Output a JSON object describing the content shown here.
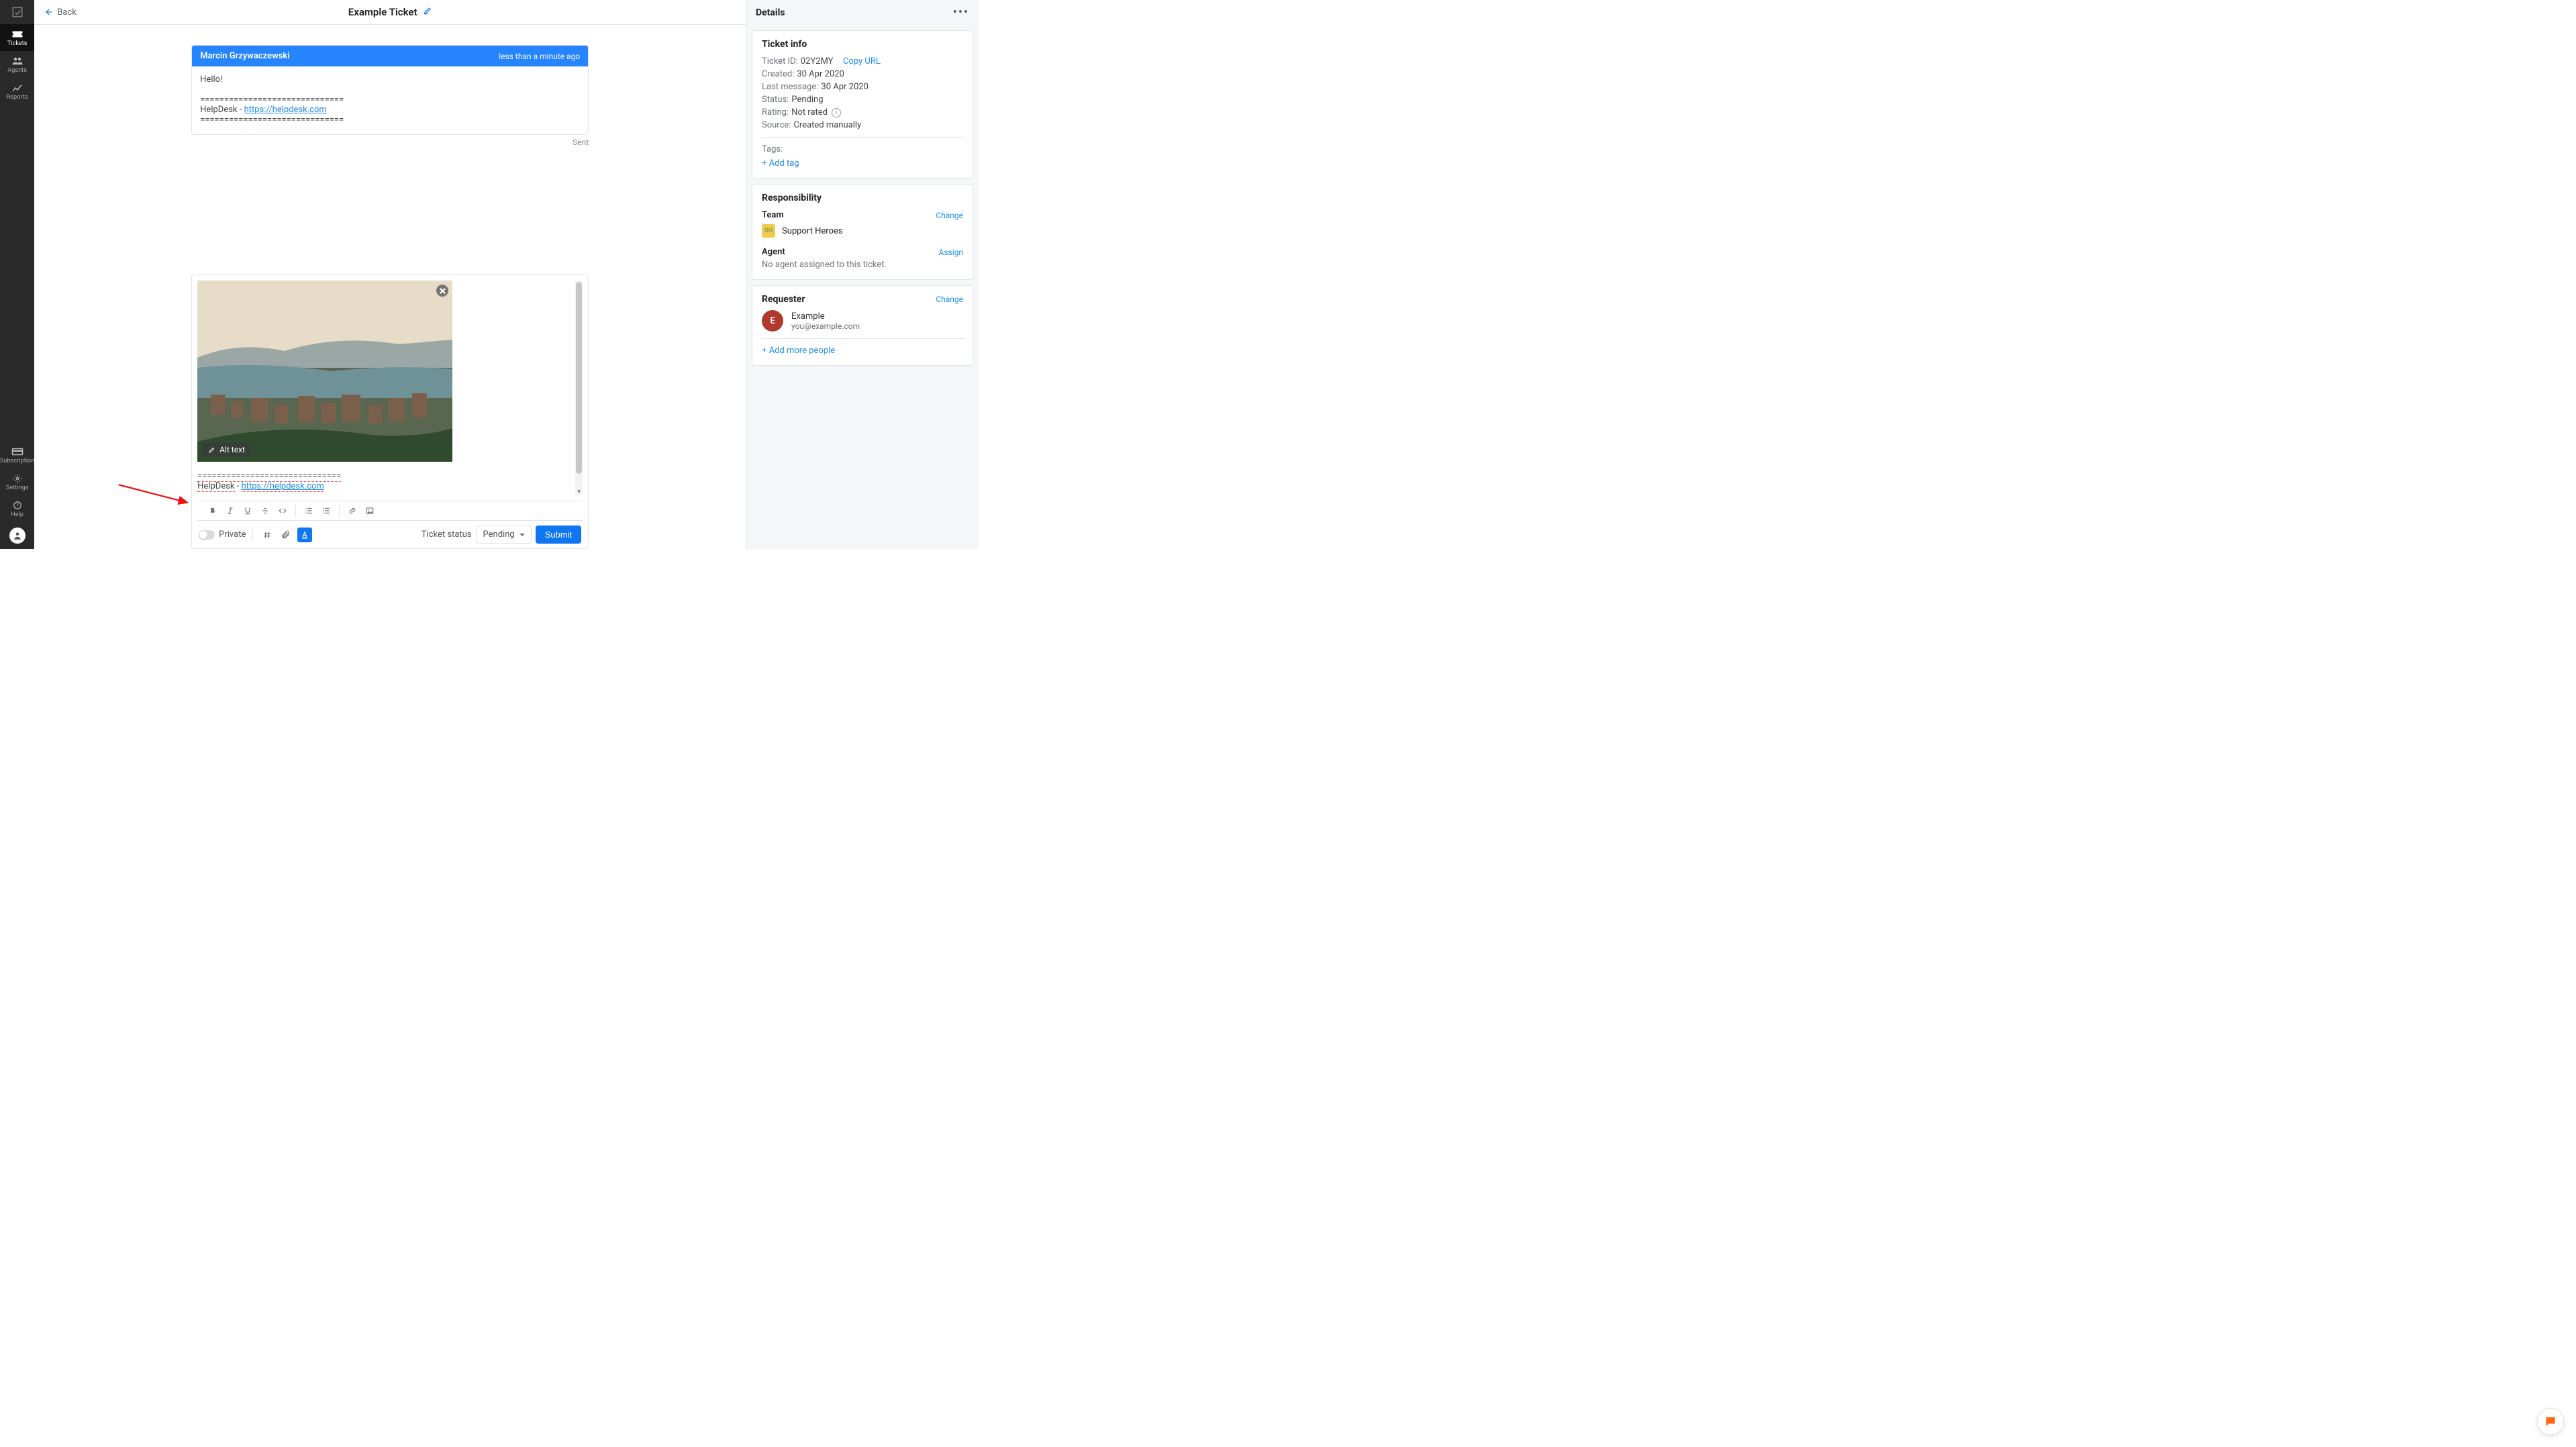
{
  "sidebar": {
    "items": [
      {
        "label": "Tickets",
        "icon": "ticket-icon",
        "active": true
      },
      {
        "label": "Agents",
        "icon": "agents-icon",
        "active": false
      },
      {
        "label": "Reports",
        "icon": "reports-icon",
        "active": false
      }
    ],
    "bottom_items": [
      {
        "label": "Subscription",
        "icon": "card-icon"
      },
      {
        "label": "Settings",
        "icon": "gear-icon"
      },
      {
        "label": "Help",
        "icon": "help-icon"
      }
    ]
  },
  "topbar": {
    "back": "Back",
    "title": "Example Ticket"
  },
  "message": {
    "author": "Marcin Grzywaczewski",
    "time": "less than a minute ago",
    "greeting": "Hello!",
    "divider": "==============================",
    "sig_prefix": "HelpDesk - ",
    "sig_link": "https://helpdesk.com",
    "status": "Sent"
  },
  "composer": {
    "alt_text_label": "Alt text",
    "sig_divider": "==============================",
    "sig_prefix": "HelpDesk",
    "sig_dash": " - ",
    "sig_link": "https://helpdesk.com",
    "private_label": "Private",
    "status_label": "Ticket status",
    "status_value": "Pending",
    "submit": "Submit"
  },
  "details": {
    "heading": "Details",
    "ticket_info": {
      "title": "Ticket info",
      "id_label": "Ticket ID:",
      "id": "02Y2MY",
      "copy": "Copy URL",
      "created_label": "Created:",
      "created": "30 Apr 2020",
      "last_label": "Last message:",
      "last": "30 Apr 2020",
      "status_label": "Status:",
      "status": "Pending",
      "rating_label": "Rating:",
      "rating": "Not rated",
      "source_label": "Source:",
      "source": "Created manually",
      "tags_label": "Tags:",
      "add_tag": "+ Add tag"
    },
    "responsibility": {
      "title": "Responsibility",
      "team_label": "Team",
      "team_action": "Change",
      "team_badge": "SH",
      "team_name": "Support Heroes",
      "agent_label": "Agent",
      "agent_action": "Assign",
      "agent_none": "No agent assigned to this ticket."
    },
    "requester": {
      "title": "Requester",
      "action": "Change",
      "avatar": "E",
      "name": "Example",
      "email": "you@example.com",
      "add_more": "+ Add more people"
    }
  }
}
